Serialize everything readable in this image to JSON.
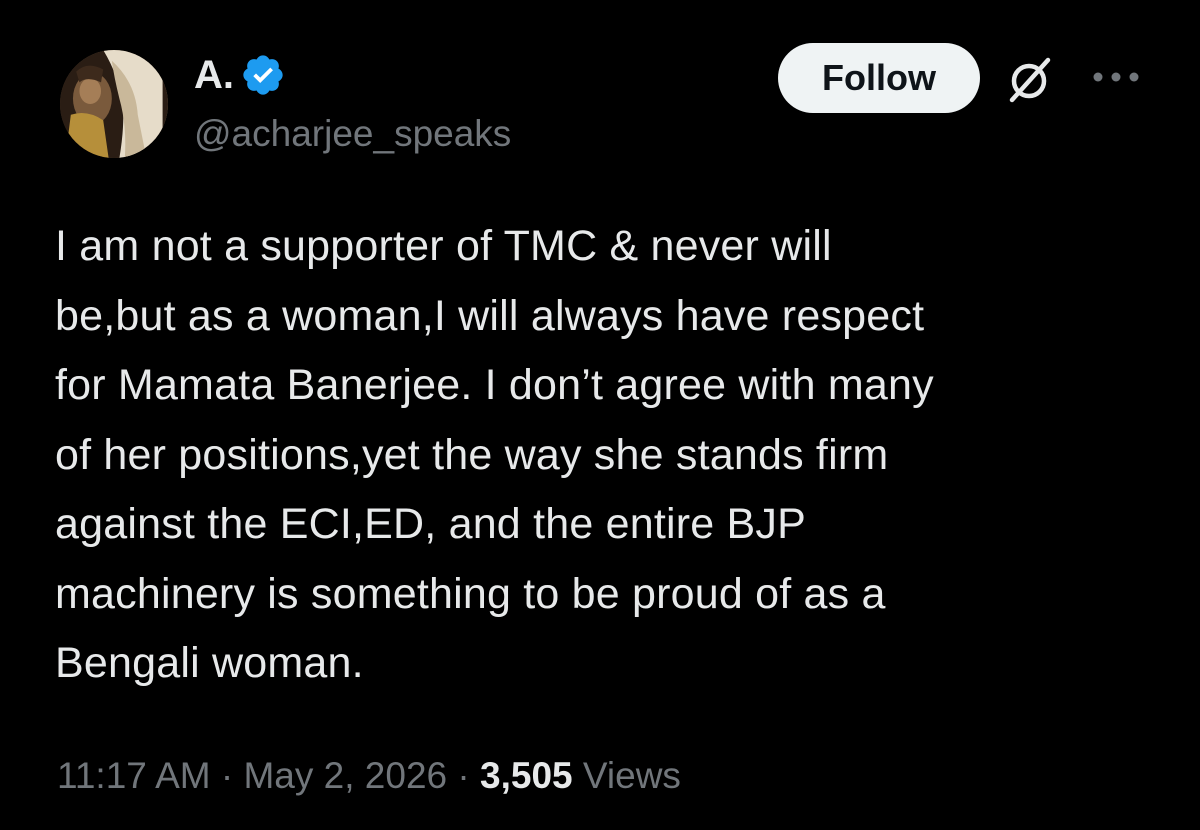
{
  "author": {
    "display_name": "A.",
    "handle": "@acharjee_speaks",
    "verified": true,
    "verified_color": "#1d9bf0"
  },
  "actions": {
    "follow_label": "Follow",
    "grok_icon": "grok-icon",
    "more_icon": "more-icon"
  },
  "tweet": {
    "text": "I am not a supporter of TMC & never will\nbe,but as a woman,I will always have respect\nfor Mamata Banerjee. I don’t agree with many\nof her positions,yet the way she stands firm\nagainst the ECI,ED, and the entire BJP\nmachinery is something to be proud of as a\nBengali woman."
  },
  "meta": {
    "time": "11:17 AM",
    "separator": "·",
    "date": "May 2, 2026",
    "views_count": "3,505",
    "views_label": "Views"
  },
  "colors": {
    "background": "#000000",
    "primary_text": "#e7e9ea",
    "secondary_text": "#71767b",
    "follow_bg": "#eff3f4"
  }
}
